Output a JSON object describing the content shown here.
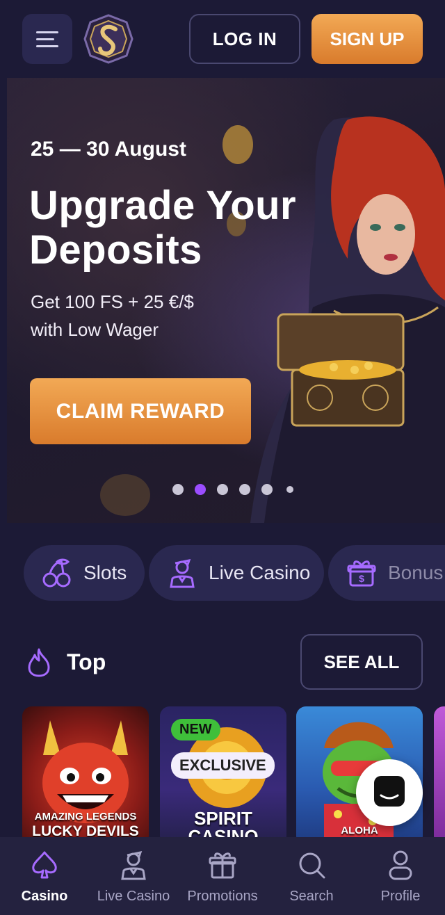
{
  "header": {
    "login_label": "LOG IN",
    "signup_label": "SIGN UP"
  },
  "banner": {
    "date": "25 — 30 August",
    "title_line1": "Upgrade Your",
    "title_line2": "Deposits",
    "subtitle_line1": "Get 100 FS + 25 €/$",
    "subtitle_line2": "with Low Wager",
    "cta_label": "CLAIM REWARD",
    "slides_total": 6,
    "active_slide": 2
  },
  "categories": [
    {
      "label": "Slots",
      "icon": "cherries-icon"
    },
    {
      "label": "Live Casino",
      "icon": "dealer-icon"
    },
    {
      "label": "Bonus",
      "icon": "gift-icon"
    }
  ],
  "top_section": {
    "title": "Top",
    "see_all_label": "SEE ALL",
    "games": [
      {
        "title_small": "AMAZING LEGENDS",
        "title": "LUCKY DEVILS"
      },
      {
        "badge_new": "NEW",
        "badge_exclusive": "EXCLUSIVE",
        "title": "SPIRIT",
        "title2": "CASINO"
      },
      {
        "title": "ALOHA"
      }
    ]
  },
  "bottom_nav": [
    {
      "label": "Casino",
      "icon": "spade-icon",
      "active": true
    },
    {
      "label": "Live Casino",
      "icon": "dealer-icon",
      "active": false
    },
    {
      "label": "Promotions",
      "icon": "gift-icon",
      "active": false
    },
    {
      "label": "Search",
      "icon": "search-icon",
      "active": false
    },
    {
      "label": "Profile",
      "icon": "user-icon",
      "active": false
    }
  ],
  "colors": {
    "background": "#1c1a36",
    "accent_orange": "#e8913f",
    "accent_purple": "#9b4dff",
    "pill_bg": "#2a2850"
  }
}
